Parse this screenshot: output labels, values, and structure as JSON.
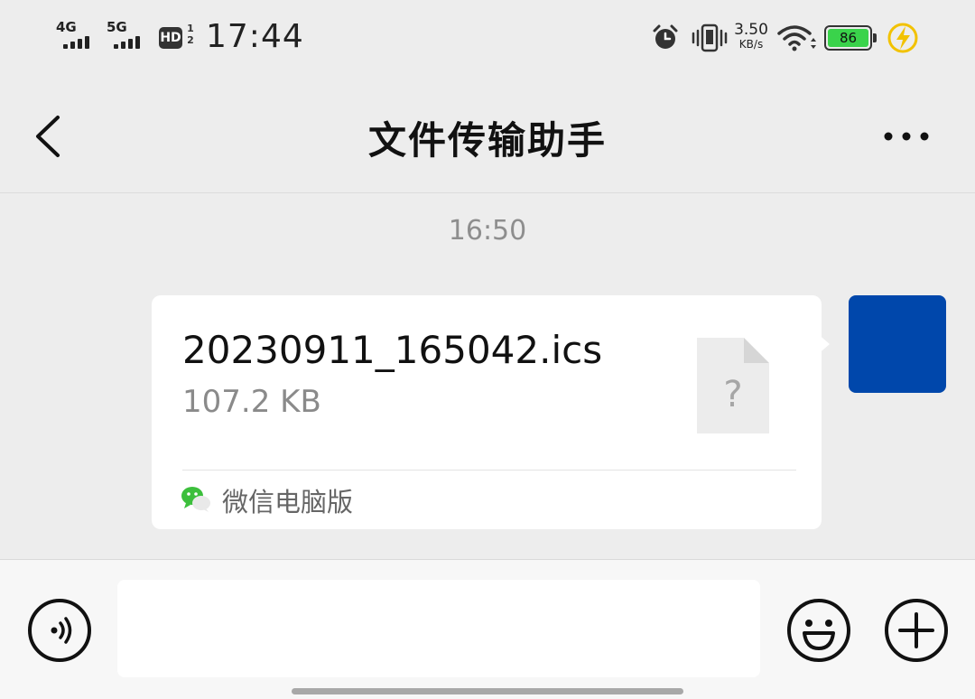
{
  "status_bar": {
    "sim1_network": "4G",
    "sim2_network": "5G",
    "hd_label": "HD",
    "hd_sub": "1 2",
    "time": "17:44",
    "net_speed_value": "3.50",
    "net_speed_unit": "KB/s",
    "battery_level": "86",
    "battery_color": "#3ad34b",
    "icons": [
      "alarm-icon",
      "vibrate-icon",
      "wifi-icon",
      "charging-icon"
    ]
  },
  "header": {
    "title": "文件传输助手",
    "icons": [
      "back-icon",
      "more-icon"
    ]
  },
  "chat": {
    "timestamp": "16:50",
    "message": {
      "file_name": "20230911_165042.ics",
      "file_size": "107.2 KB",
      "file_icon_glyph": "?",
      "source_label": "微信电脑版",
      "avatar_color": "#0047ab"
    }
  },
  "input_bar": {
    "placeholder": "",
    "icons": [
      "voice-icon",
      "emoji-icon",
      "plus-icon"
    ]
  }
}
